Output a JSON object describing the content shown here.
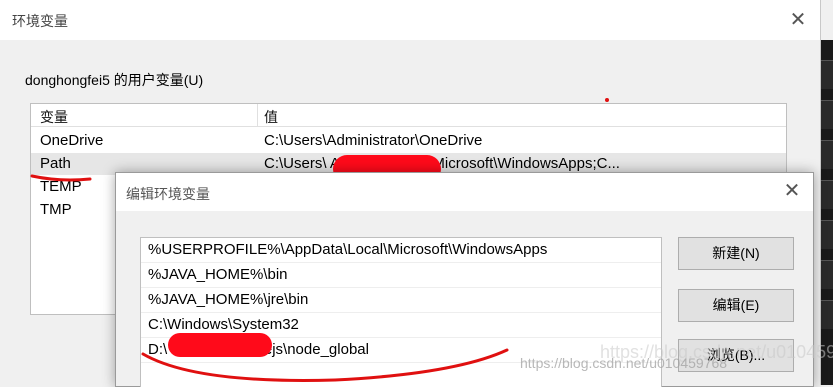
{
  "env_window": {
    "title": "环境变量",
    "close_glyph": "✕",
    "user_section_label": "donghongfei5 的用户变量(U)",
    "columns": [
      "变量",
      "值"
    ],
    "rows": [
      {
        "name": "OneDrive",
        "value": "C:\\Users\\Administrator\\OneDrive"
      },
      {
        "name": "Path",
        "value": "C:\\Users\\                    AppData\\Local\\Microsoft\\WindowsApps;C..."
      },
      {
        "name": "TEMP",
        "value": ""
      },
      {
        "name": "TMP",
        "value": ""
      }
    ]
  },
  "edit_dialog": {
    "title": "编辑环境变量",
    "close_glyph": "✕",
    "entries": [
      "%USERPROFILE%\\AppData\\Local\\Microsoft\\WindowsApps",
      "%JAVA_HOME%\\bin",
      "%JAVA_HOME%\\jre\\bin",
      "C:\\Windows\\System32",
      "D:\\                              \\software\\Nodejs\\node_global"
    ],
    "buttons": {
      "new": "新建(N)",
      "edit": "编辑(E)",
      "browse": "浏览(B)..."
    }
  },
  "watermark": "https://blog.csdn.net/u010459768",
  "colors": {
    "annotation_red": "#e01010",
    "window_bg": "#f0f0f0",
    "list_bg": "#ffffff",
    "button_bg": "#e1e1e1"
  }
}
